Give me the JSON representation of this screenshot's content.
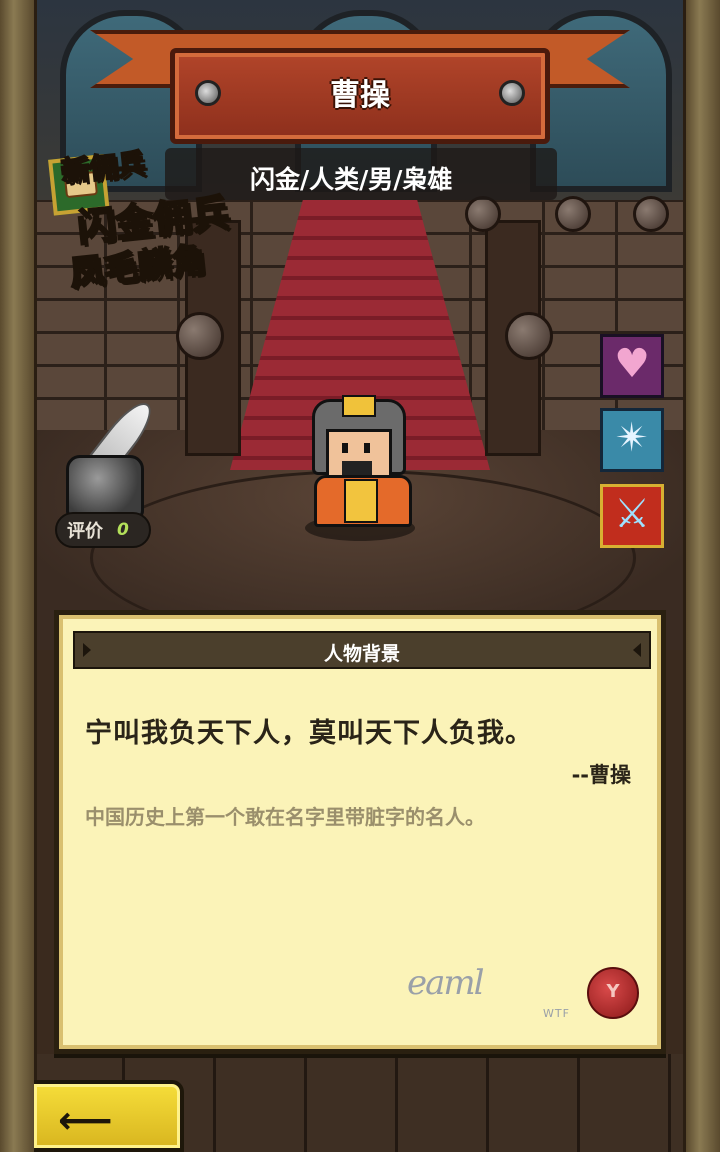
{
  "header": {
    "title": "曹操",
    "subtitle": "闪金/人类/男/枭雄"
  },
  "promo": {
    "line1": "新佣兵",
    "line2": "闪金佣兵",
    "line3": "凤毛麟角"
  },
  "rating": {
    "label": "评价",
    "value": "0"
  },
  "skills": [
    {
      "icon": "broken-heart-icon"
    },
    {
      "icon": "magic-circle-shield-icon"
    },
    {
      "icon": "sword-icon"
    }
  ],
  "panel": {
    "title": "人物背景",
    "quote": "宁叫我负天下人，莫叫天下人负我。",
    "attribution": "--曹操",
    "description": "中国历史上第一个敢在名字里带脏字的名人。",
    "signature": "eaml",
    "signature_tag": "WTF"
  },
  "colors": {
    "banner": "#b2452a",
    "panel_bg": "#fbf3b8",
    "back_button": "#f6de3a",
    "promo_text": "#f6e53a"
  }
}
